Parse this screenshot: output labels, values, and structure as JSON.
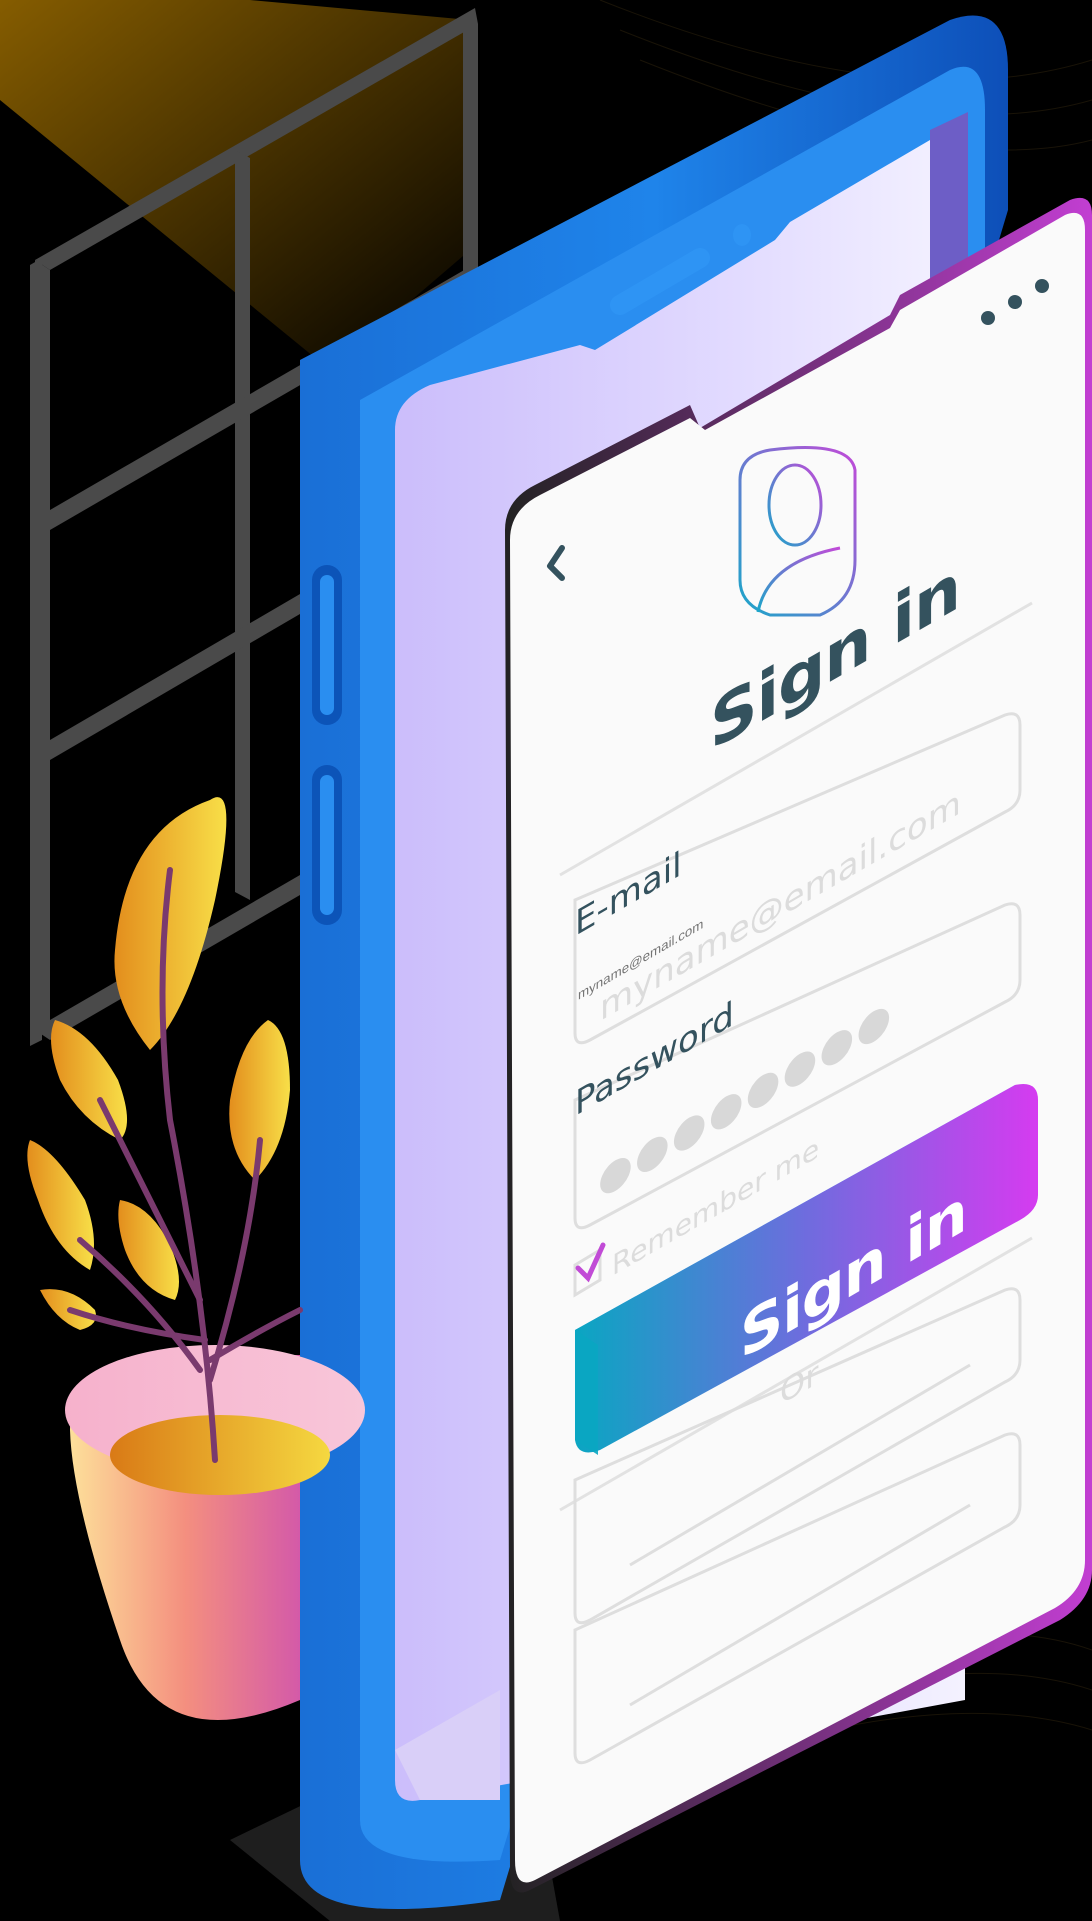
{
  "signin": {
    "title": "Sign in",
    "email_label": "E-mail",
    "email_placeholder": "myname@email.com",
    "password_label": "Password",
    "password_value": "●●●●●●●●",
    "remember_label": "Remember me",
    "remember_checked": true,
    "button_label": "Sign in",
    "or_label": "Or"
  },
  "colors": {
    "phone_blue": "#1f7fe0",
    "screen_lavender": "#cfc3fb",
    "button_start": "#0aa6c2",
    "button_end": "#d53bf0",
    "text_dark": "#34525e",
    "field_outline": "#dedede",
    "accent_magenta": "#c14bd6"
  },
  "icons": {
    "back": "chevron-left-icon",
    "menu": "more-dots-icon",
    "avatar": "user-avatar-icon",
    "checkbox": "checkmark-icon"
  }
}
